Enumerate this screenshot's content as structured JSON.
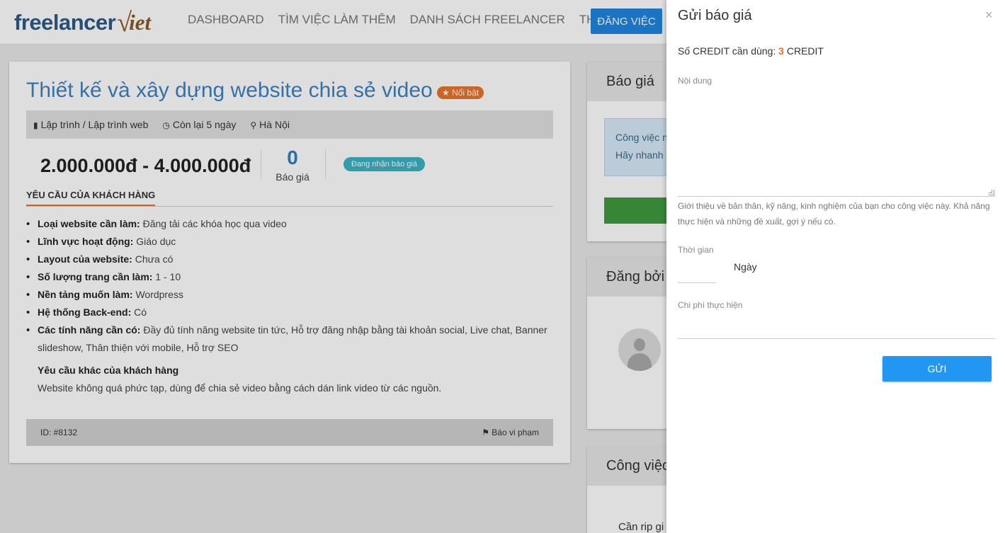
{
  "header": {
    "logo_part1": "freelancer",
    "logo_part2": "iet",
    "nav": [
      "DASHBOARD",
      "TÌM VIỆC LÀM THÊM",
      "DANH SÁCH FREELANCER",
      "THỐNG K"
    ],
    "post_button": "ĐĂNG VIỆC"
  },
  "job": {
    "title": "Thiết kế và xây dựng website chia sẻ video",
    "featured_badge": "Nổi bật",
    "category": "Lập trình / Lập trình web",
    "remaining": "Còn lại 5 ngày",
    "location": "Hà Nội",
    "budget": "2.000.000đ - 4.000.000đ",
    "bid_count": "0",
    "bid_label": "Báo giá",
    "status": "Đang nhận báo giá",
    "section_heading": "YÊU CẦU CỦA KHÁCH HÀNG",
    "requirements": [
      {
        "label": "Loại website cần làm:",
        "value": "Đăng tải các khóa học qua video"
      },
      {
        "label": "Lĩnh vực hoạt động:",
        "value": "Giáo dục"
      },
      {
        "label": "Layout của website:",
        "value": "Chưa có"
      },
      {
        "label": "Số lượng trang cần làm:",
        "value": "1 - 10"
      },
      {
        "label": "Nền tảng muốn làm:",
        "value": "Wordpress"
      },
      {
        "label": "Hệ thống Back-end:",
        "value": "Có"
      },
      {
        "label": "Các tính năng cần có:",
        "value": "Đầy đủ tính năng website tin tức, Hỗ trợ đăng nhập bằng tài khoản social, Live chat, Banner slideshow, Thân thiện với mobile, Hỗ trợ SEO"
      }
    ],
    "extra_title": "Yêu cầu khác của khách hàng",
    "extra_text": "Website không quá phức tạp, dùng để chia sẻ video bằng cách dán link video từ các nguồn.",
    "id_text": "ID: #8132",
    "report": "Báo vi phạm"
  },
  "sidebar": {
    "quote_title": "Báo giá",
    "info_line1": "Công việc n",
    "info_line2": "Hãy nhanh t",
    "posted_by_title": "Đăng bởi",
    "jobs_title": "Công việc",
    "jobs_snippet": "Cần rip gi"
  },
  "modal": {
    "title": "Gửi báo giá",
    "credit_prefix": "Số CREDIT cần dùng:",
    "credit_value": "3",
    "credit_suffix": "CREDIT",
    "content_label": "Nội dung",
    "content_help": "Giới thiệu về bản thân, kỹ năng, kinh nghiệm của bạn cho công việc này. Khả năng thực hiện và những đề xuất, gợi ý nếu có.",
    "time_label": "Thời gian",
    "time_unit": "Ngày",
    "cost_label": "Chi phí thực hiện",
    "submit": "GỬI"
  }
}
